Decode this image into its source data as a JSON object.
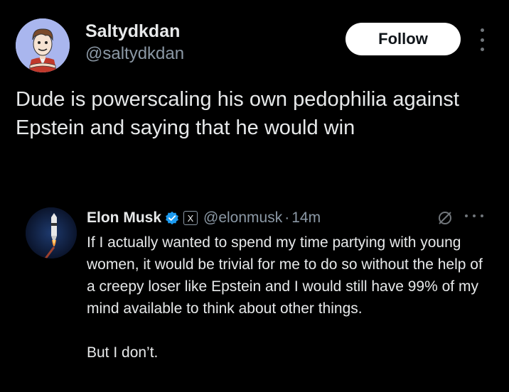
{
  "post": {
    "author": {
      "display_name": "Saltydkdan",
      "handle": "@saltydkdan",
      "avatar_icon": "cartoon-man-avatar"
    },
    "follow_label": "Follow",
    "text": "Dude is powerscaling his own pedophilia against Epstein and saying that he would win"
  },
  "quoted_post": {
    "author": {
      "display_name": "Elon Musk",
      "x_badge": "X",
      "handle": "@elonmusk",
      "separator": "·",
      "time": "14m",
      "avatar_icon": "rocket-avatar"
    },
    "paragraphs": [
      "If I actually wanted to spend my time partying with young women, it would be trivial for me to do so without the help of a creepy loser like Epstein and I would still have 99% of my mind available to think about other things.",
      "",
      "But I don’t."
    ]
  },
  "colors": {
    "background": "#000000",
    "text_primary": "#e7e9ea",
    "text_secondary": "#8b98a5",
    "verified": "#1d9bf0"
  }
}
